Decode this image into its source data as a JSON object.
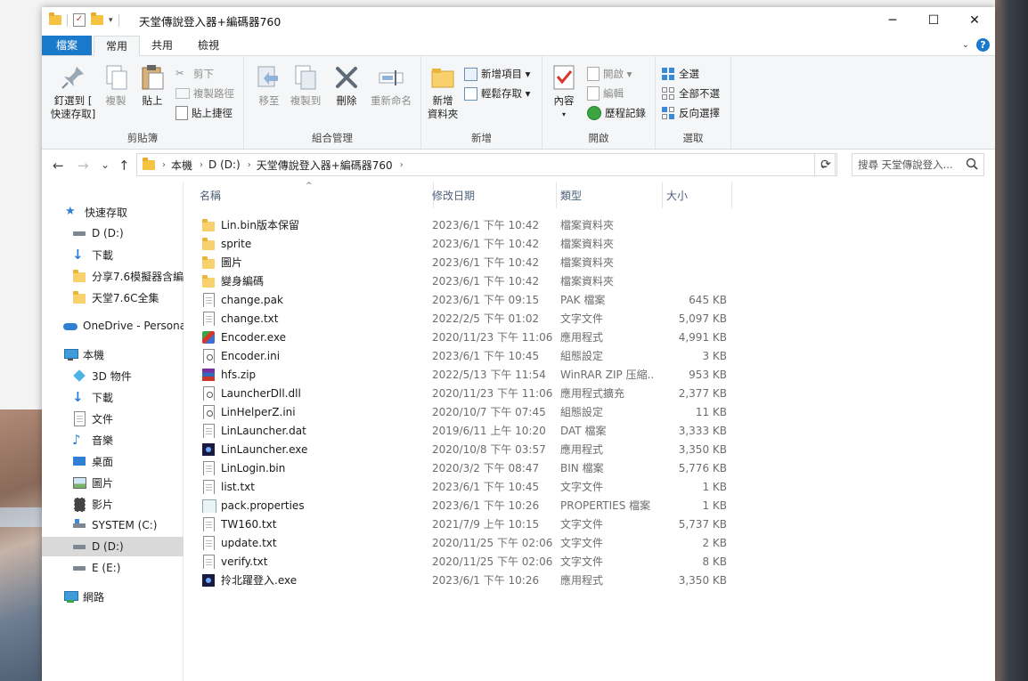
{
  "window": {
    "title": "天堂傳說登入器+編碼器760",
    "minimize": "─",
    "maximize": "☐",
    "close": "✕"
  },
  "tabs": {
    "file": "檔案",
    "home": "常用",
    "share": "共用",
    "view": "檢視",
    "help": "?"
  },
  "ribbon": {
    "clipboard": {
      "label": "剪貼簿",
      "pin_line1": "釘選到 [",
      "pin_line2": "快速存取]",
      "copy": "複製",
      "paste": "貼上",
      "cut": "剪下",
      "copy_path": "複製路徑",
      "paste_shortcut": "貼上捷徑"
    },
    "organize": {
      "label": "組合管理",
      "move_to": "移至",
      "copy_to": "複製到",
      "delete": "刪除",
      "rename": "重新命名"
    },
    "new": {
      "label": "新增",
      "new_folder_line1": "新增",
      "new_folder_line2": "資料夾",
      "new_item": "新增項目 ▾",
      "easy_access": "輕鬆存取 ▾"
    },
    "open": {
      "label": "開啟",
      "properties": "內容",
      "open": "開啟 ▾",
      "edit": "編輯",
      "history": "歷程記錄"
    },
    "select": {
      "label": "選取",
      "select_all": "全選",
      "select_none": "全部不選",
      "invert": "反向選擇"
    }
  },
  "address": {
    "back": "←",
    "forward": "→",
    "recent": "⌄",
    "up": "↑",
    "crumbs": [
      "本機",
      "D (D:)",
      "天堂傳說登入器+編碼器760"
    ],
    "dropdown": "⌄",
    "refresh": "⟳",
    "search_placeholder": "搜尋 天堂傳說登入..."
  },
  "navpane": {
    "quick_access": "快速存取",
    "quick_items": [
      "D (D:)",
      "下載",
      "分享7.6模擬器含編",
      "天堂7.6C全集"
    ],
    "onedrive": "OneDrive - Personal",
    "this_pc": "本機",
    "pc_items": [
      "3D 物件",
      "下載",
      "文件",
      "音樂",
      "桌面",
      "圖片",
      "影片",
      "SYSTEM (C:)",
      "D (D:)",
      "E (E:)"
    ],
    "network": "網路"
  },
  "columns": {
    "name": "名稱",
    "date": "修改日期",
    "type": "類型",
    "size": "大小",
    "sort_arrow": "^"
  },
  "files": [
    {
      "name": "Lin.bin版本保留",
      "date": "2023/6/1 下午 10:42",
      "type": "檔案資料夾",
      "size": "",
      "icon": "folder"
    },
    {
      "name": "sprite",
      "date": "2023/6/1 下午 10:42",
      "type": "檔案資料夾",
      "size": "",
      "icon": "folder"
    },
    {
      "name": "圖片",
      "date": "2023/6/1 下午 10:42",
      "type": "檔案資料夾",
      "size": "",
      "icon": "folder"
    },
    {
      "name": "變身編碼",
      "date": "2023/6/1 下午 10:42",
      "type": "檔案資料夾",
      "size": "",
      "icon": "folder"
    },
    {
      "name": "change.pak",
      "date": "2023/6/1 下午 09:15",
      "type": "PAK 檔案",
      "size": "645 KB",
      "icon": "doc"
    },
    {
      "name": "change.txt",
      "date": "2022/2/5 下午 01:02",
      "type": "文字文件",
      "size": "5,097 KB",
      "icon": "doc"
    },
    {
      "name": "Encoder.exe",
      "date": "2020/11/23 下午 11:06",
      "type": "應用程式",
      "size": "4,991 KB",
      "icon": "encoder"
    },
    {
      "name": "Encoder.ini",
      "date": "2023/6/1 下午 10:45",
      "type": "組態設定",
      "size": "3 KB",
      "icon": "gear"
    },
    {
      "name": "hfs.zip",
      "date": "2022/5/13 下午 11:54",
      "type": "WinRAR ZIP 压縮...",
      "size": "953 KB",
      "icon": "zip"
    },
    {
      "name": "LauncherDll.dll",
      "date": "2020/11/23 下午 11:06",
      "type": "應用程式擴充",
      "size": "2,377 KB",
      "icon": "gear"
    },
    {
      "name": "LinHelperZ.ini",
      "date": "2020/10/7 下午 07:45",
      "type": "組態設定",
      "size": "11 KB",
      "icon": "gear"
    },
    {
      "name": "LinLauncher.dat",
      "date": "2019/6/11 上午 10:20",
      "type": "DAT 檔案",
      "size": "3,333 KB",
      "icon": "doc"
    },
    {
      "name": "LinLauncher.exe",
      "date": "2020/10/8 下午 03:57",
      "type": "應用程式",
      "size": "3,350 KB",
      "icon": "exe"
    },
    {
      "name": "LinLogin.bin",
      "date": "2020/3/2 下午 08:47",
      "type": "BIN 檔案",
      "size": "5,776 KB",
      "icon": "doc"
    },
    {
      "name": "list.txt",
      "date": "2023/6/1 下午 10:45",
      "type": "文字文件",
      "size": "1 KB",
      "icon": "doc"
    },
    {
      "name": "pack.properties",
      "date": "2023/6/1 下午 10:26",
      "type": "PROPERTIES 檔案",
      "size": "1 KB",
      "icon": "prop"
    },
    {
      "name": "TW160.txt",
      "date": "2021/7/9 上午 10:15",
      "type": "文字文件",
      "size": "5,737 KB",
      "icon": "doc"
    },
    {
      "name": "update.txt",
      "date": "2020/11/25 下午 02:06",
      "type": "文字文件",
      "size": "2 KB",
      "icon": "doc"
    },
    {
      "name": "verify.txt",
      "date": "2020/11/25 下午 02:06",
      "type": "文字文件",
      "size": "8 KB",
      "icon": "doc"
    },
    {
      "name": "拎北躍登入.exe",
      "date": "2023/6/1 下午 10:26",
      "type": "應用程式",
      "size": "3,350 KB",
      "icon": "exe"
    }
  ],
  "colors": {
    "accent": "#1979ca",
    "folder": "#f8d16c",
    "selection": "#d9d9d9"
  }
}
